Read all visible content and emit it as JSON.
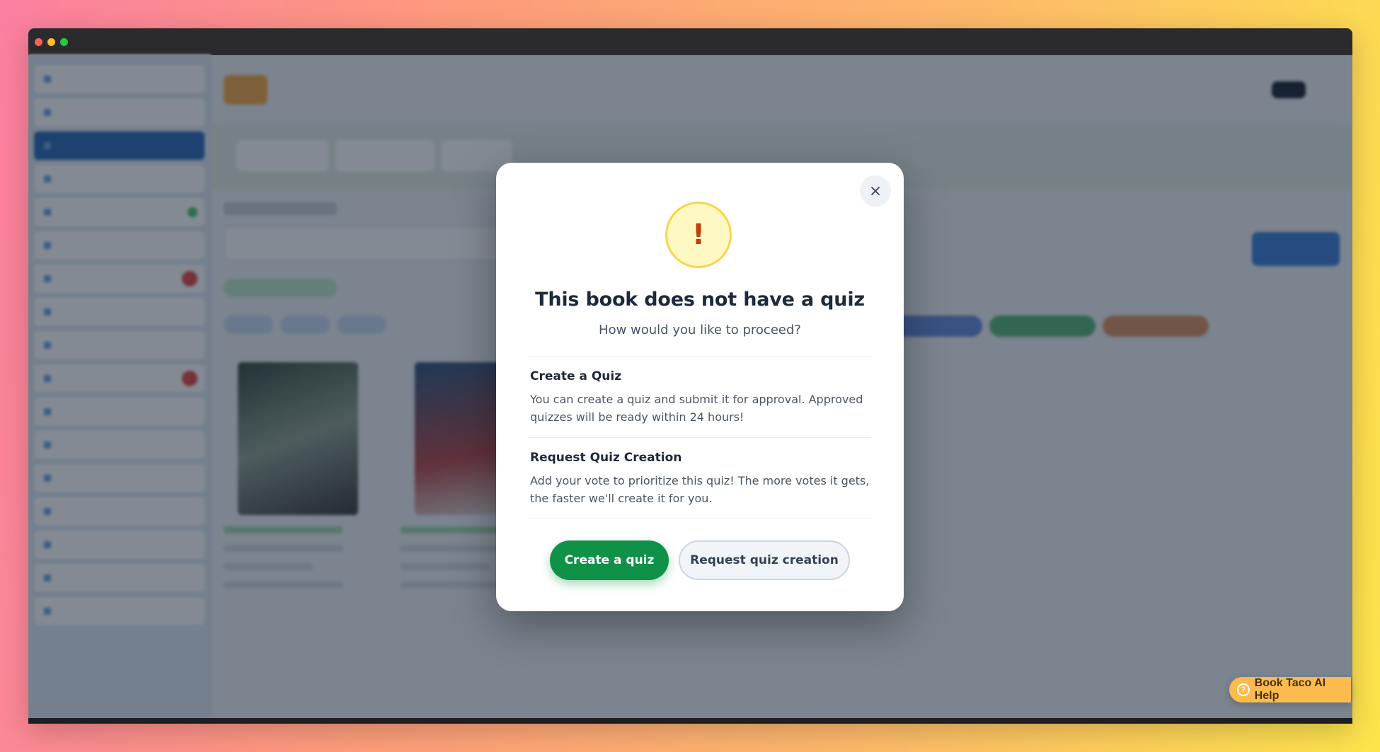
{
  "colors": {
    "accent_green": "#0f9148",
    "warning_bg": "#fef9c3",
    "warning_border": "#fcd34d",
    "warning_mark": "#c2410c",
    "help_pill": "#fdbb4d"
  },
  "modal": {
    "warning_glyph": "!",
    "title": "This book does not have a quiz",
    "subtitle": "How would you like to proceed?",
    "options": [
      {
        "title": "Create a Quiz",
        "description": "You can create a quiz and submit it for approval. Approved quizzes will be ready within 24 hours!"
      },
      {
        "title": "Request Quiz Creation",
        "description": "Add your vote to prioritize this quiz! The more votes it gets, the faster we'll create it for you."
      }
    ],
    "primary_button": "Create a quiz",
    "secondary_button": "Request quiz creation",
    "close_icon": "close-icon"
  },
  "help_widget": {
    "icon": "question-circle-icon",
    "label": "Book Taco AI Help"
  }
}
